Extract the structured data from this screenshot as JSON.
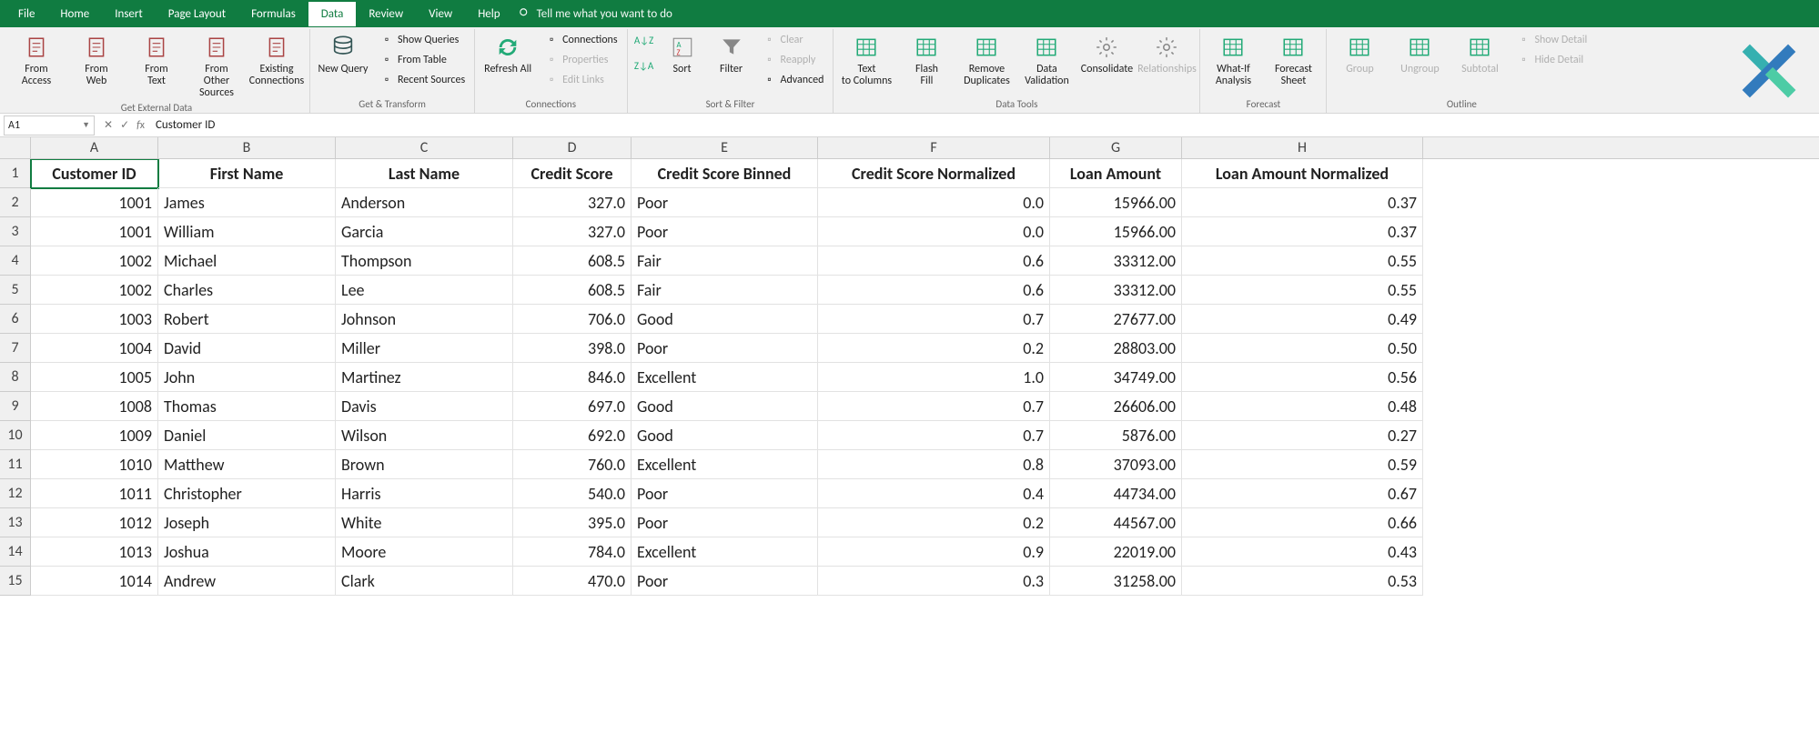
{
  "menu": {
    "tabs": [
      "File",
      "Home",
      "Insert",
      "Page Layout",
      "Formulas",
      "Data",
      "Review",
      "View",
      "Help"
    ],
    "active": 5,
    "tell": "Tell me what you want to do"
  },
  "ribbon": {
    "get_ext": {
      "label": "Get External Data",
      "items": [
        "From Access",
        "From Web",
        "From Text",
        "From Other Sources",
        "Existing Connections"
      ]
    },
    "get_trans": {
      "label": "Get & Transform",
      "new_query": "New Query",
      "mini": [
        "Show Queries",
        "From Table",
        "Recent Sources"
      ]
    },
    "conn": {
      "label": "Connections",
      "refresh": "Refresh All",
      "mini": [
        "Connections",
        "Properties",
        "Edit Links"
      ]
    },
    "sortfilter": {
      "label": "Sort & Filter",
      "sort": "Sort",
      "filter": "Filter",
      "mini": [
        "Clear",
        "Reapply",
        "Advanced"
      ]
    },
    "datatools": {
      "label": "Data Tools",
      "items": [
        "Text to Columns",
        "Flash Fill",
        "Remove Duplicates",
        "Data Validation",
        "Consolidate",
        "Relationships"
      ]
    },
    "forecast": {
      "label": "Forecast",
      "items": [
        "What-If Analysis",
        "Forecast Sheet"
      ]
    },
    "outline": {
      "label": "Outline",
      "items": [
        "Group",
        "Ungroup",
        "Subtotal",
        "Show Detail",
        "Hide Detail"
      ]
    }
  },
  "namebox": "A1",
  "formula": "Customer ID",
  "columns": [
    "A",
    "B",
    "C",
    "D",
    "E",
    "F",
    "G",
    "H"
  ],
  "headers": [
    "Customer ID",
    "First Name",
    "Last Name",
    "Credit Score",
    "Credit Score Binned",
    "Credit Score Normalized",
    "Loan Amount",
    "Loan Amount Normalized"
  ],
  "rows": [
    [
      "1001",
      "James",
      "Anderson",
      "327.0",
      "Poor",
      "0.0",
      "15966.00",
      "0.37"
    ],
    [
      "1001",
      "William",
      "Garcia",
      "327.0",
      "Poor",
      "0.0",
      "15966.00",
      "0.37"
    ],
    [
      "1002",
      "Michael",
      "Thompson",
      "608.5",
      "Fair",
      "0.6",
      "33312.00",
      "0.55"
    ],
    [
      "1002",
      "Charles",
      "Lee",
      "608.5",
      "Fair",
      "0.6",
      "33312.00",
      "0.55"
    ],
    [
      "1003",
      "Robert",
      "Johnson",
      "706.0",
      "Good",
      "0.7",
      "27677.00",
      "0.49"
    ],
    [
      "1004",
      "David",
      "Miller",
      "398.0",
      "Poor",
      "0.2",
      "28803.00",
      "0.50"
    ],
    [
      "1005",
      "John",
      "Martinez",
      "846.0",
      "Excellent",
      "1.0",
      "34749.00",
      "0.56"
    ],
    [
      "1008",
      "Thomas",
      "Davis",
      "697.0",
      "Good",
      "0.7",
      "26606.00",
      "0.48"
    ],
    [
      "1009",
      "Daniel",
      "Wilson",
      "692.0",
      "Good",
      "0.7",
      "5876.00",
      "0.27"
    ],
    [
      "1010",
      "Matthew",
      "Brown",
      "760.0",
      "Excellent",
      "0.8",
      "37093.00",
      "0.59"
    ],
    [
      "1011",
      "Christopher",
      "Harris",
      "540.0",
      "Poor",
      "0.4",
      "44734.00",
      "0.67"
    ],
    [
      "1012",
      "Joseph",
      "White",
      "395.0",
      "Poor",
      "0.2",
      "44567.00",
      "0.66"
    ],
    [
      "1013",
      "Joshua",
      "Moore",
      "784.0",
      "Excellent",
      "0.9",
      "22019.00",
      "0.43"
    ],
    [
      "1014",
      "Andrew",
      "Clark",
      "470.0",
      "Poor",
      "0.3",
      "31258.00",
      "0.53"
    ]
  ],
  "col_align": [
    "num",
    "txt",
    "txt",
    "num",
    "txt",
    "num",
    "num",
    "num"
  ]
}
